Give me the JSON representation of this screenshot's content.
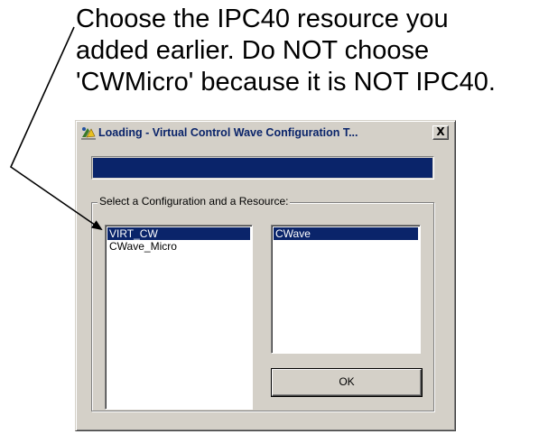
{
  "annotation": {
    "lines": [
      "Choose the IPC40 resource you",
      "added earlier. Do NOT choose",
      "'CWMicro' because it is NOT IPC40."
    ]
  },
  "dialog": {
    "title": "Loading - Virtual Control Wave Configuration T...",
    "app_icon": "app-icon",
    "close_label": "X",
    "progress": {
      "fraction": 1.0,
      "color": "#0a246a"
    },
    "group_label": "Select a Configuration and a Resource:",
    "configurations": [
      {
        "label": "VIRT_CW",
        "selected": true
      },
      {
        "label": "CWave_Micro",
        "selected": false
      }
    ],
    "resources": [
      {
        "label": "CWave",
        "selected": true
      }
    ],
    "ok_label": "OK"
  },
  "colors": {
    "dialog_face": "#d4d0c8",
    "selection": "#0a246a",
    "title_text": "#0a246a"
  }
}
